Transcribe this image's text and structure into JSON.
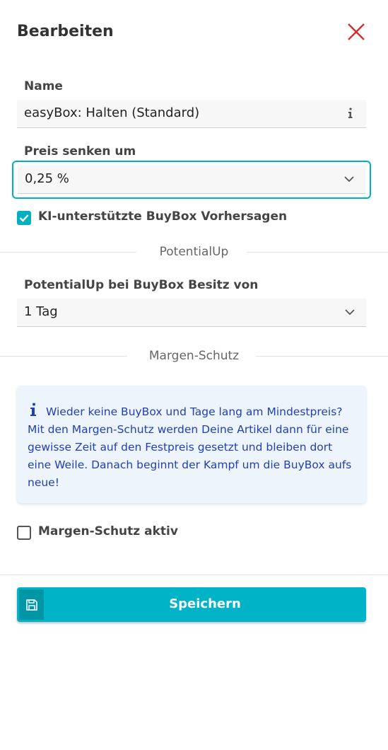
{
  "dialog": {
    "title": "Bearbeiten"
  },
  "name_field": {
    "label": "Name",
    "value": "easyBox: Halten (Standard)"
  },
  "price_field": {
    "label": "Preis senken um",
    "value": "0,25 %"
  },
  "ki_checkbox": {
    "label": "KI-unterstützte BuyBox Vorhersagen",
    "checked": true
  },
  "potentialup_section": {
    "title": "PotentialUp",
    "field_label": "PotentialUp bei BuyBox Besitz von",
    "value": "1 Tag"
  },
  "margin_section": {
    "title": "Margen-Schutz",
    "info_text": "Wieder keine BuyBox und Tage lang am Mindestpreis? Mit den Margen-Schutz werden Deine Artikel dann für eine gewisse Zeit auf den Festpreis gesetzt und bleiben dort eine Weile. Danach beginnt der Kampf um die BuyBox aufs neue!",
    "checkbox_label": "Margen-Schutz aktiv",
    "checked": false
  },
  "actions": {
    "save_label": "Speichern"
  },
  "colors": {
    "accent": "#00b3c7",
    "close": "#d03030",
    "info_text": "#2140b8",
    "info_bg": "#eef4fc"
  }
}
